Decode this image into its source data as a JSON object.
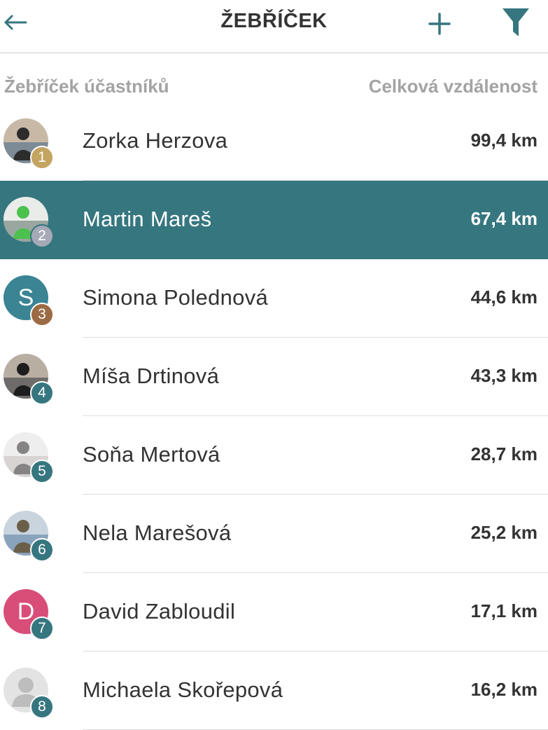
{
  "header": {
    "title": "ŽEBŘÍČEK",
    "accent": "#36767f"
  },
  "columns": {
    "left": "Žebříček účastníků",
    "right": "Celková vzdálenost"
  },
  "rows": [
    {
      "rank": "1",
      "name": "Zorka Herzova",
      "distance": "99,4 km",
      "avatar": "photo",
      "rank_color": "#c3a460",
      "active": false
    },
    {
      "rank": "2",
      "name": "Martin Mareš",
      "distance": "67,4 km",
      "avatar": "photo",
      "rank_color": "#a6a9b6",
      "active": true
    },
    {
      "rank": "3",
      "name": "Simona Polednová",
      "distance": "44,6 km",
      "avatar": "initial",
      "initial": "S",
      "avatar_color": "#3a8494",
      "rank_color": "#9c6a44",
      "active": false
    },
    {
      "rank": "4",
      "name": "Míša Drtinová",
      "distance": "43,3 km",
      "avatar": "photo",
      "rank_color": "#36767f",
      "active": false
    },
    {
      "rank": "5",
      "name": "Soňa Mertová",
      "distance": "28,7 km",
      "avatar": "photo",
      "rank_color": "#36767f",
      "active": false
    },
    {
      "rank": "6",
      "name": "Nela Marešová",
      "distance": "25,2 km",
      "avatar": "photo",
      "rank_color": "#36767f",
      "active": false
    },
    {
      "rank": "7",
      "name": "David Zabloudil",
      "distance": "17,1 km",
      "avatar": "initial",
      "initial": "D",
      "avatar_color": "#d84e79",
      "rank_color": "#36767f",
      "active": false
    },
    {
      "rank": "8",
      "name": "Michaela Skořepová",
      "distance": "16,2 km",
      "avatar": "placeholder",
      "rank_color": "#36767f",
      "active": false
    }
  ]
}
